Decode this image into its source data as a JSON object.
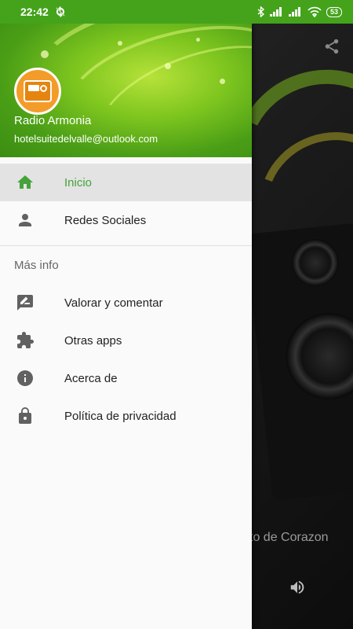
{
  "status_bar": {
    "time": "22:42",
    "battery": "53"
  },
  "drawer": {
    "app_name": "Radio Armonia",
    "email": "hotelsuitedelvalle@outlook.com",
    "items": [
      {
        "label": "Inicio",
        "icon": "home-icon",
        "active": true
      },
      {
        "label": "Redes Sociales",
        "icon": "person-icon",
        "active": false
      }
    ],
    "section_title": "Más info",
    "more_items": [
      {
        "label": "Valorar y comentar",
        "icon": "rate-review-icon"
      },
      {
        "label": "Otras apps",
        "icon": "extension-icon"
      },
      {
        "label": "Acerca de",
        "icon": "info-icon"
      },
      {
        "label": "Política de privacidad",
        "icon": "lock-icon"
      }
    ]
  },
  "background": {
    "now_playing": "to de Corazon"
  },
  "colors": {
    "accent": "#44a33a",
    "header_green": "#4a9e16",
    "active_bg": "#e3e3e3"
  }
}
